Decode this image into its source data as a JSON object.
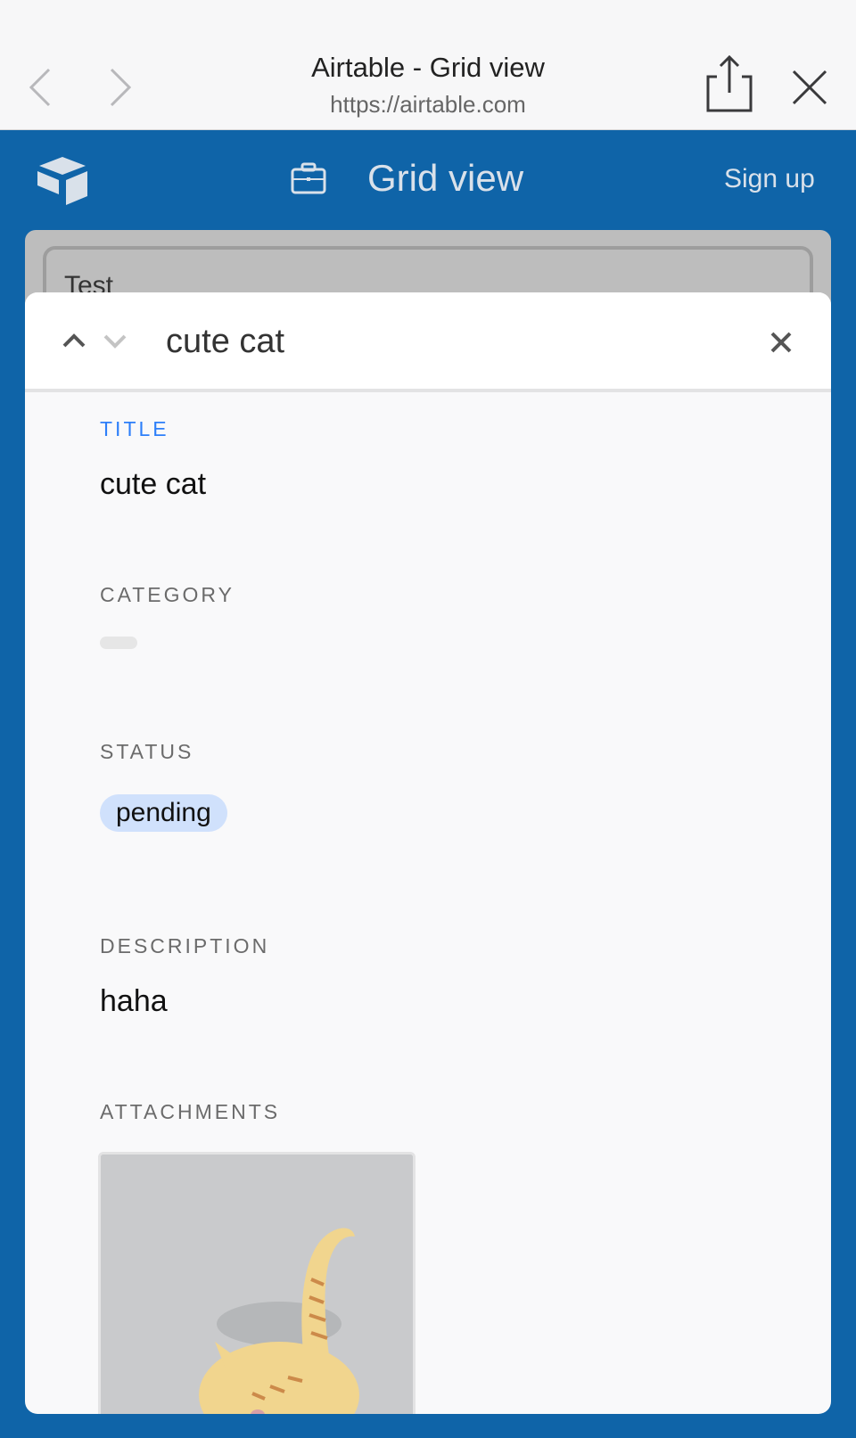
{
  "browser": {
    "page_title": "Airtable - Grid view",
    "url": "https://airtable.com"
  },
  "app_header": {
    "view_name": "Grid view",
    "signup_label": "Sign up"
  },
  "background_card": {
    "text": "Test"
  },
  "record": {
    "title": "cute cat",
    "fields": [
      {
        "label": "TITLE",
        "value": "cute cat"
      },
      {
        "label": "CATEGORY",
        "value": ""
      },
      {
        "label": "STATUS",
        "value": "pending"
      },
      {
        "label": "DESCRIPTION",
        "value": "haha"
      },
      {
        "label": "ATTACHMENTS",
        "value": ""
      }
    ]
  },
  "colors": {
    "brand_blue": "#0f64a8",
    "active_label": "#2d7ff9",
    "status_pill": "#d0e1fc"
  },
  "icons": {
    "back": "chevron-left-icon",
    "forward": "chevron-right-icon",
    "share": "share-icon",
    "close": "close-icon",
    "logo": "airtable-logo",
    "briefcase": "briefcase-icon",
    "up": "chevron-up-icon",
    "down": "chevron-down-icon"
  }
}
